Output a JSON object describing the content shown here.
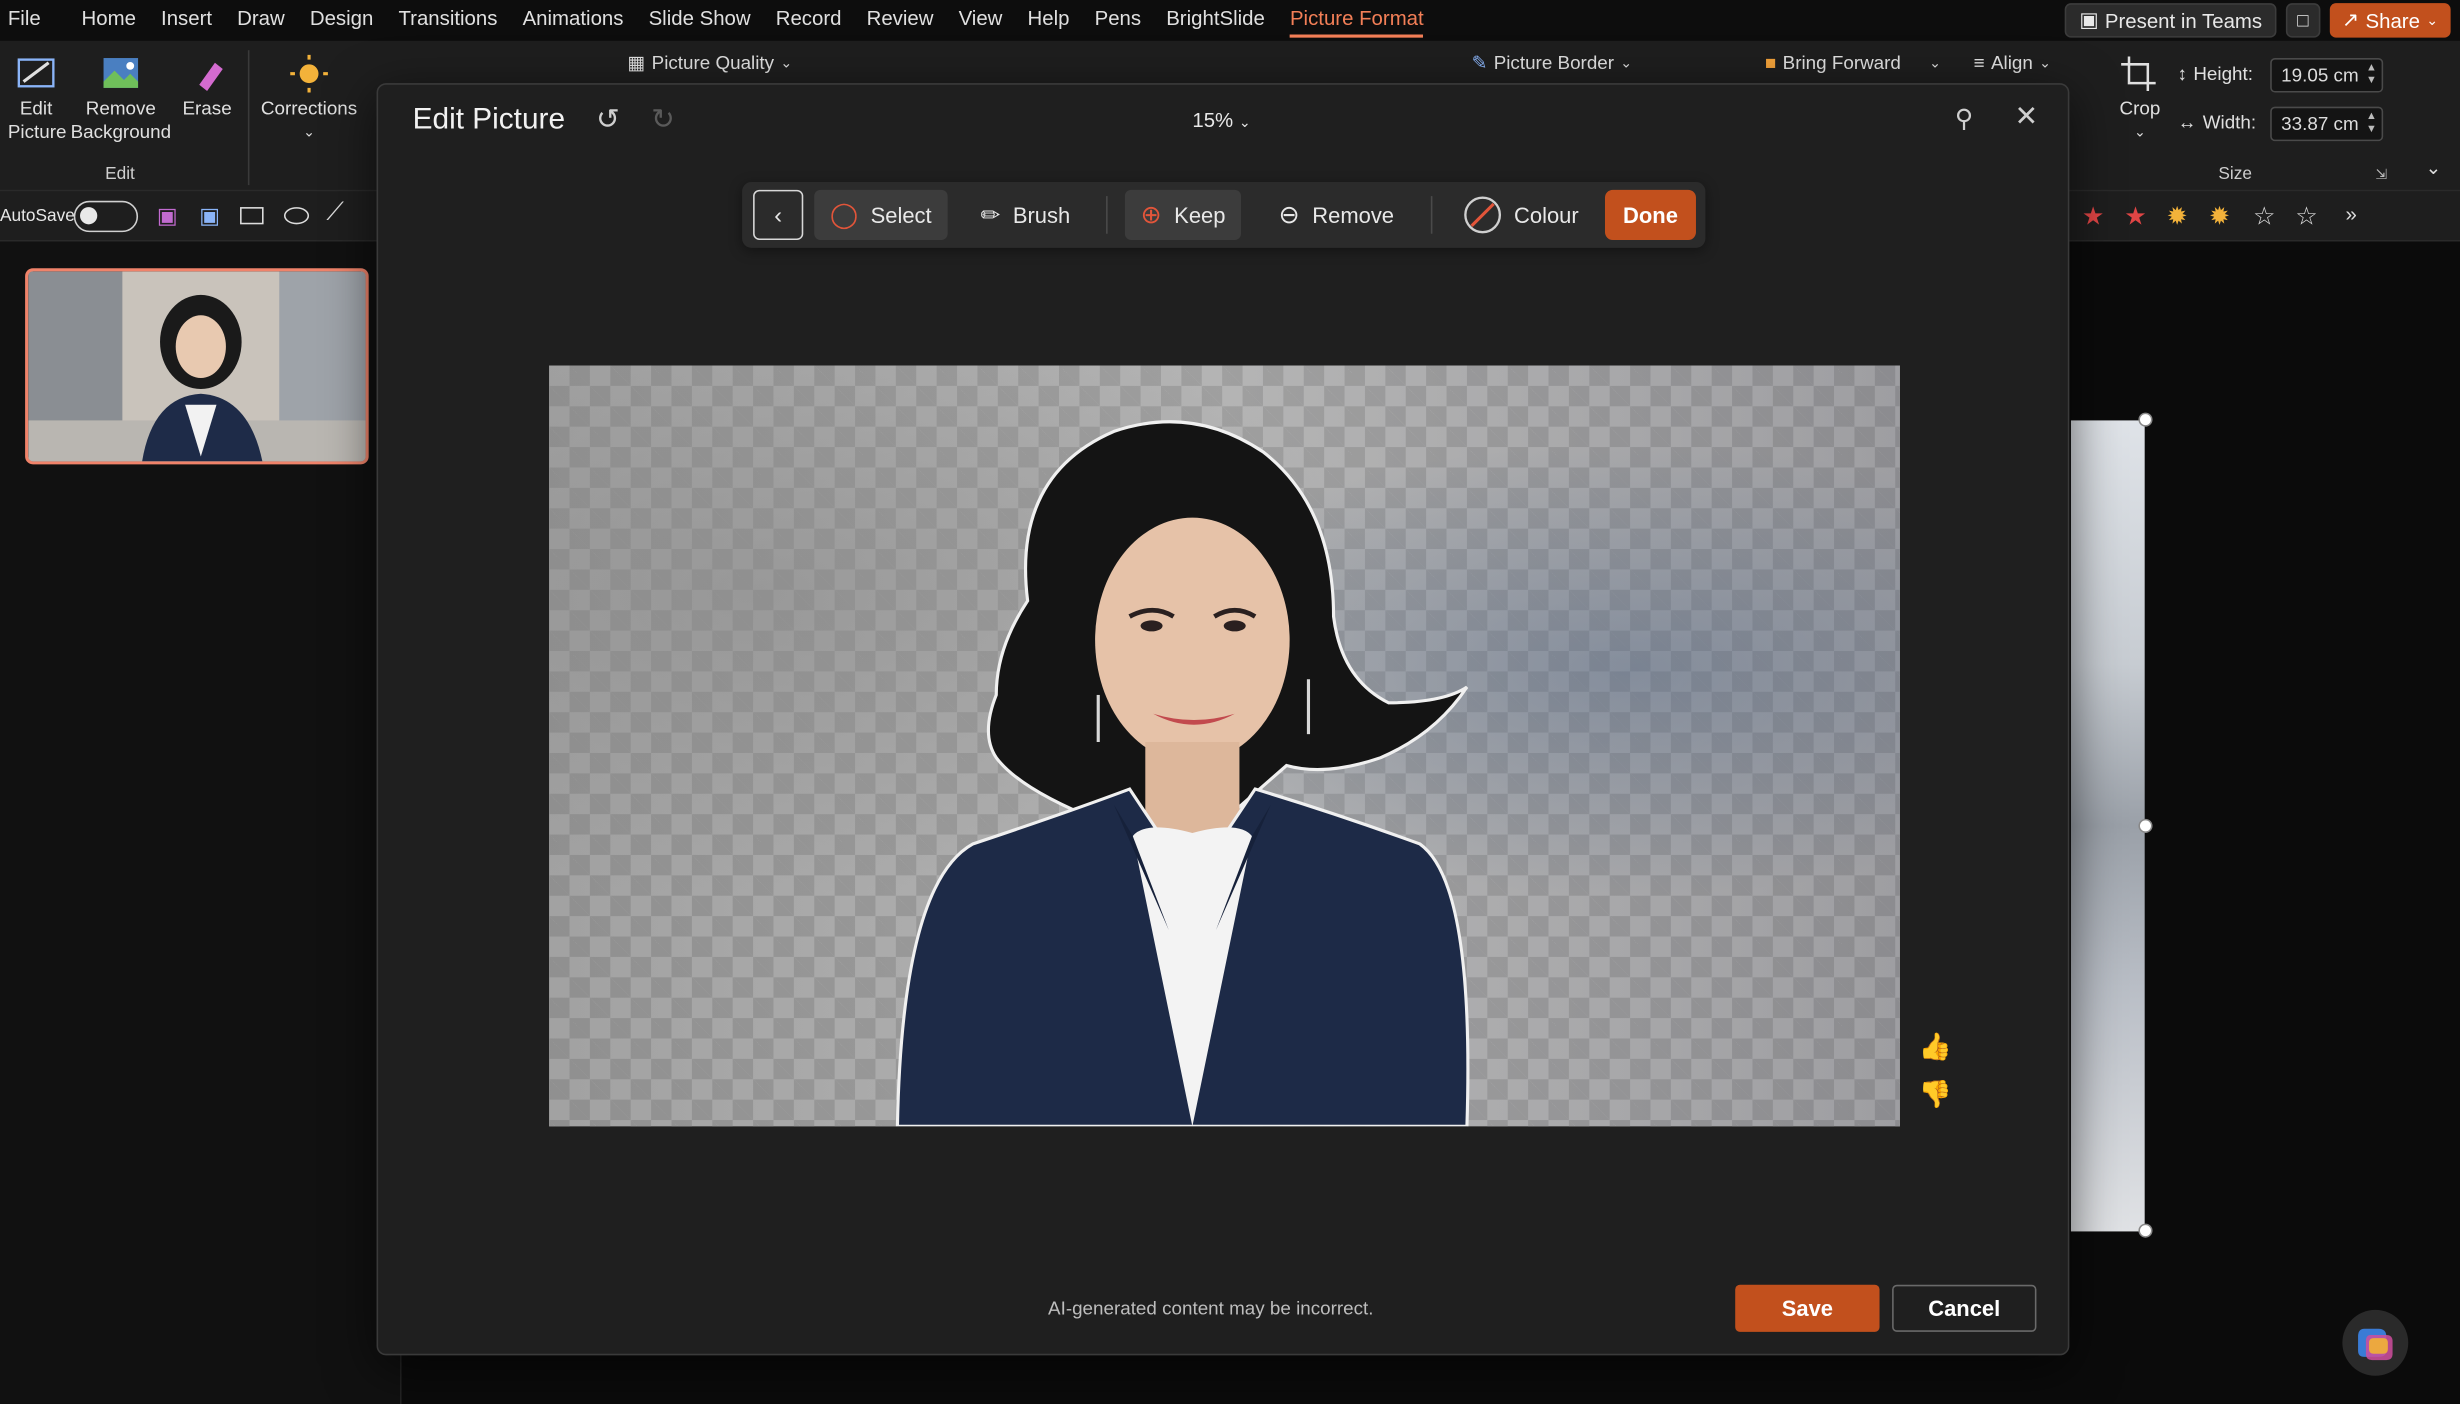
{
  "menu": {
    "items": [
      "File",
      "Home",
      "Insert",
      "Draw",
      "Design",
      "Transitions",
      "Animations",
      "Slide Show",
      "Record",
      "Review",
      "View",
      "Help",
      "Pens",
      "BrightSlide",
      "Picture Format"
    ],
    "active": "Picture Format",
    "present_teams": "Present in Teams",
    "share": "Share"
  },
  "ribbon": {
    "edit_picture": "Edit Picture",
    "remove_background": "Remove Background",
    "erase": "Erase",
    "edit_group": "Edit",
    "corrections": "Corrections",
    "picture_quality": "Picture Quality",
    "picture_border": "Picture Border",
    "bring_forward": "Bring Forward",
    "align": "Align",
    "crop": "Crop",
    "height_label": "Height:",
    "height_value": "19.05 cm",
    "width_label": "Width:",
    "width_value": "33.87 cm",
    "size_group": "Size"
  },
  "qat": {
    "autosave": "AutoSave"
  },
  "dialog": {
    "title": "Edit Picture",
    "zoom": "15%",
    "toolbar": {
      "select": "Select",
      "brush": "Brush",
      "keep": "Keep",
      "remove": "Remove",
      "colour": "Colour",
      "done": "Done"
    },
    "ai_note": "AI-generated content may be incorrect.",
    "save": "Save",
    "cancel": "Cancel"
  },
  "colors": {
    "accent": "#c2501d",
    "active_tab": "#f37f57",
    "thumb_border": "#f0836a"
  }
}
